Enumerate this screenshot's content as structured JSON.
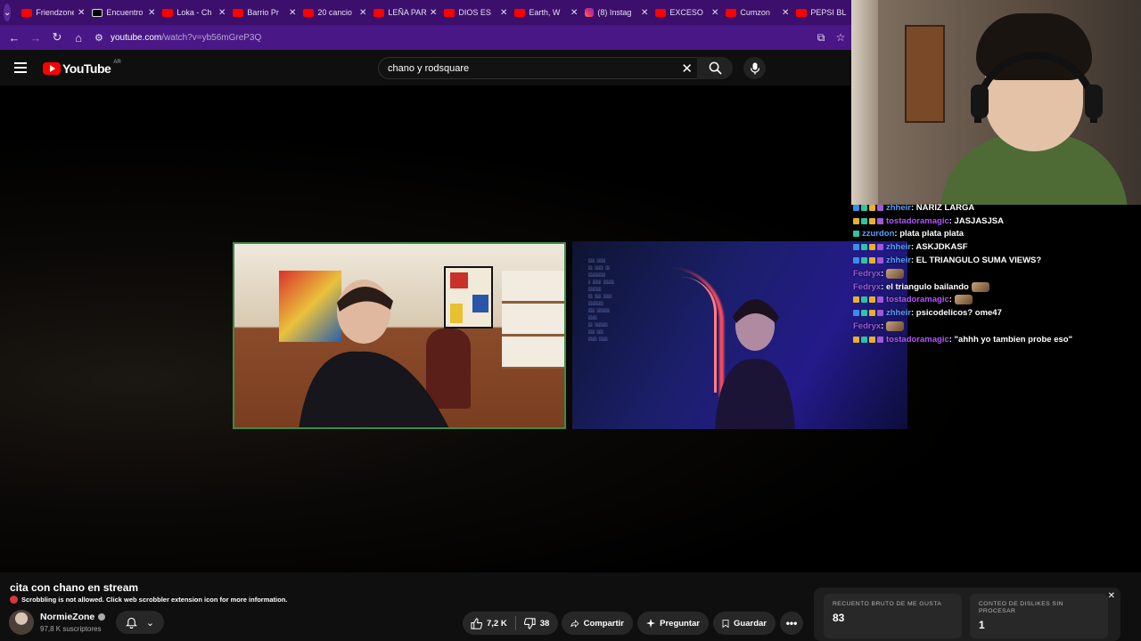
{
  "browser": {
    "tabs": [
      {
        "title": "Friendzone",
        "icon": "youtube-icon"
      },
      {
        "title": "Encuentro",
        "icon": "tiktok-icon"
      },
      {
        "title": "Loka - Ch",
        "icon": "youtube-icon"
      },
      {
        "title": "Barrio Pr",
        "icon": "youtube-icon"
      },
      {
        "title": "20 cancio",
        "icon": "youtube-icon"
      },
      {
        "title": "LEÑA PAR",
        "icon": "youtube-icon"
      },
      {
        "title": "DIOS ES",
        "icon": "youtube-icon"
      },
      {
        "title": "Earth, W",
        "icon": "youtube-icon"
      },
      {
        "title": "(8) Instag",
        "icon": "instagram-icon"
      },
      {
        "title": "EXCESO",
        "icon": "youtube-icon"
      },
      {
        "title": "Cumzon",
        "icon": "youtube-icon"
      },
      {
        "title": "PEPSI BL",
        "icon": "youtube-icon"
      }
    ],
    "url_host": "youtube.com",
    "url_path": "/watch?v=yb56mGreP3Q",
    "theme_color": "#4a1786"
  },
  "youtube": {
    "logo_text": "YouTube",
    "country_code": "AR",
    "search_query": "chano y rodsquare",
    "video_title": "cita con chano en stream",
    "scrobble_notice": "Scrobbling is not allowed. Click web scrobbler extension icon for more information.",
    "channel_name": "NormieZone",
    "subscribers": "97,8 K suscriptores",
    "like_count": "7,2 K",
    "dislike_count": "38",
    "share_label": "Compartir",
    "ask_label": "Preguntar",
    "save_label": "Guardar"
  },
  "ryd_panel": {
    "likes_label": "RECUENTO BRUTO DE ME GUSTA",
    "likes_value": "83",
    "dislikes_label": "CONTEO DE DISLIKES SIN PROCESAR",
    "dislikes_value": "1"
  },
  "chat": [
    {
      "user": "zhheir",
      "color": "#5aa0ff",
      "message": ": NARIZ LARGA",
      "badges": [
        "b-blue",
        "b-green",
        "b-gold",
        "b-purple"
      ]
    },
    {
      "user": "tostadoramagic",
      "color": "#b455ff",
      "message": ": JASJASJSA",
      "badges": [
        "b-gold",
        "b-green",
        "b-gold",
        "b-purple"
      ]
    },
    {
      "user": "zzurdon",
      "color": "#5aa0ff",
      "message": ": plata plata plata",
      "badges": [
        "b-green"
      ]
    },
    {
      "user": "zhheir",
      "color": "#5aa0ff",
      "message": ": ASKJDKASF",
      "badges": [
        "b-blue",
        "b-green",
        "b-gold",
        "b-purple"
      ]
    },
    {
      "user": "zhheir",
      "color": "#5aa0ff",
      "message": ": EL TRIANGULO SUMA VIEWS?",
      "badges": [
        "b-blue",
        "b-green",
        "b-gold",
        "b-purple"
      ]
    },
    {
      "user": "Fedryx",
      "color": "#9b59d8",
      "message": ":",
      "badges": [],
      "emote": true
    },
    {
      "user": "Fedryx",
      "color": "#9b59d8",
      "message": ": el triangulo bailando",
      "badges": [],
      "emote": true
    },
    {
      "user": "tostadoramagic",
      "color": "#b455ff",
      "message": ":",
      "badges": [
        "b-gold",
        "b-green",
        "b-gold",
        "b-purple"
      ],
      "emote": true
    },
    {
      "user": "zhheir",
      "color": "#5aa0ff",
      "message": ": psicodelicos? ome47",
      "badges": [
        "b-blue",
        "b-green",
        "b-gold",
        "b-purple"
      ]
    },
    {
      "user": "Fedryx",
      "color": "#9b59d8",
      "message": ":",
      "badges": [],
      "emote": true
    },
    {
      "user": "tostadoramagic",
      "color": "#b455ff",
      "message": ": \"ahhh yo tambien probe eso\"",
      "badges": [
        "b-gold",
        "b-green",
        "b-gold",
        "b-purple"
      ]
    }
  ]
}
